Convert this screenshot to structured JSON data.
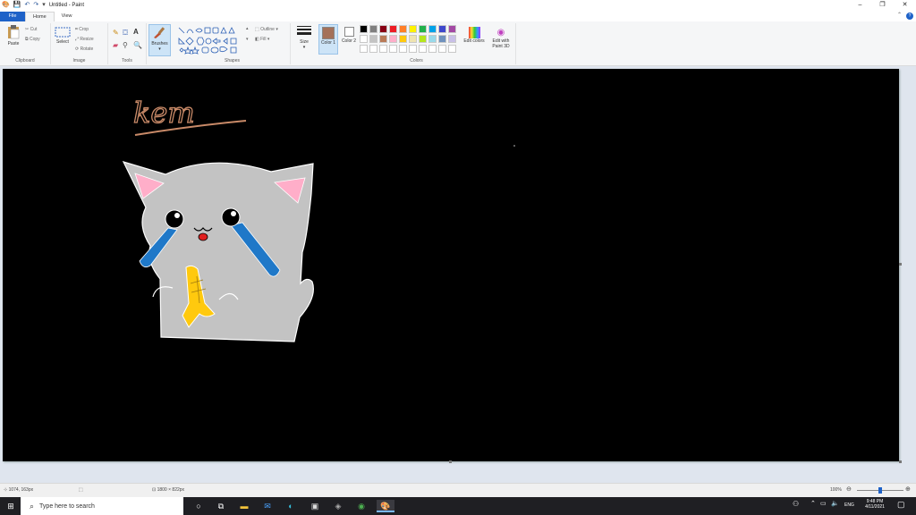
{
  "window": {
    "title": "Untitled - Paint",
    "controls": {
      "minimize": "–",
      "restore": "❐",
      "close": "✕"
    }
  },
  "tabs": [
    {
      "label": "File"
    },
    {
      "label": "Home"
    },
    {
      "label": "View"
    }
  ],
  "ribbon": {
    "clipboard": {
      "group": "Clipboard",
      "paste": "Paste",
      "cut": "Cut",
      "copy": "Copy"
    },
    "image": {
      "group": "Image",
      "select": "Select",
      "crop": "Crop",
      "resize": "Resize",
      "rotate": "Rotate"
    },
    "tools": {
      "group": "Tools"
    },
    "brushes": {
      "label": "Brushes"
    },
    "shapes": {
      "group": "Shapes",
      "outline": "Outline",
      "fill": "Fill"
    },
    "size": {
      "label": "Size"
    },
    "colors": {
      "group": "Colors",
      "color1": "Color 1",
      "color2": "Color 2",
      "edit_colors": "Edit colors",
      "edit_paint3d": "Edit with Paint 3D",
      "color1_value": "#a4715a",
      "color2_value": "#ffffff",
      "palette_row1": [
        "#000000",
        "#7f7f7f",
        "#880015",
        "#ed1c24",
        "#ff7f27",
        "#fff200",
        "#22b14c",
        "#00a2e8",
        "#3f48cc",
        "#a349a4"
      ],
      "palette_row2": [
        "#ffffff",
        "#c3c3c3",
        "#b97a57",
        "#ffaec9",
        "#ffc90e",
        "#efe4b0",
        "#b5e61d",
        "#99d9ea",
        "#7092be",
        "#c8bfe7"
      ]
    }
  },
  "canvas": {
    "handwriting": "kem"
  },
  "status": {
    "cursor_pos": "1074, 163px",
    "selection_size": "",
    "canvas_size": "1800 × 822px",
    "zoom": "100%"
  },
  "taskbar": {
    "search_placeholder": "Type here to search",
    "language": "ENG",
    "time": "9:48 PM",
    "date": "4/11/2021"
  }
}
